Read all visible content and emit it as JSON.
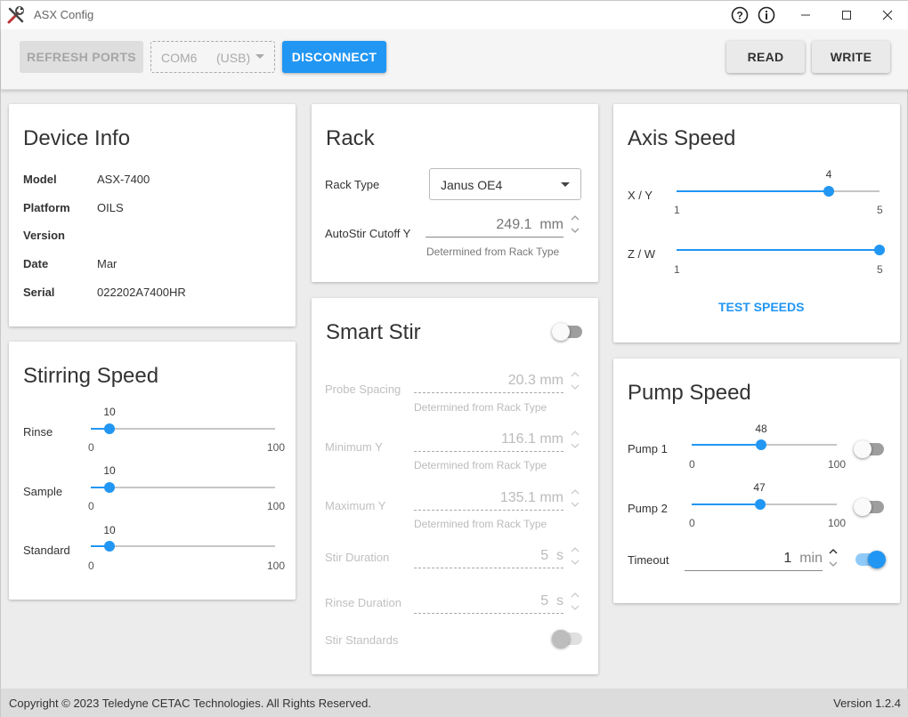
{
  "window": {
    "title": "ASX Config",
    "controls": {
      "help_icon": "help-icon",
      "info_icon": "info-icon"
    }
  },
  "toolbar": {
    "refresh_label": "REFRESH PORTS",
    "port_name": "COM6",
    "port_type": "(USB)",
    "disconnect_label": "DISCONNECT",
    "read_label": "READ",
    "write_label": "WRITE"
  },
  "device_info": {
    "title": "Device Info",
    "rows": [
      {
        "label": "Model",
        "value": "ASX-7400"
      },
      {
        "label": "Platform",
        "value": "OILS"
      },
      {
        "label": "Version",
        "value": ""
      },
      {
        "label": "Date",
        "value": "Mar"
      },
      {
        "label": "Serial",
        "value": "022202A7400HR"
      }
    ]
  },
  "stirring_speed": {
    "title": "Stirring Speed",
    "sliders": [
      {
        "label": "Rinse",
        "value": "10",
        "min": "0",
        "max": "100",
        "fraction": 0.1
      },
      {
        "label": "Sample",
        "value": "10",
        "min": "0",
        "max": "100",
        "fraction": 0.1
      },
      {
        "label": "Standard",
        "value": "10",
        "min": "0",
        "max": "100",
        "fraction": 0.1
      }
    ]
  },
  "rack": {
    "title": "Rack",
    "rack_type_label": "Rack Type",
    "rack_type_value": "Janus OE4",
    "autostir_label": "AutoStir Cutoff Y",
    "autostir_value": "249.1",
    "autostir_unit": "mm",
    "autostir_hint": "Determined from Rack Type"
  },
  "smart_stir": {
    "title": "Smart Stir",
    "enabled": false,
    "fields": [
      {
        "label": "Probe Spacing",
        "value": "20.3",
        "unit": "mm",
        "hint": "Determined from Rack Type"
      },
      {
        "label": "Minimum Y",
        "value": "116.1",
        "unit": "mm",
        "hint": "Determined from Rack Type"
      },
      {
        "label": "Maximum Y",
        "value": "135.1",
        "unit": "mm",
        "hint": "Determined from Rack Type"
      },
      {
        "label": "Stir Duration",
        "value": "5",
        "unit": "s",
        "hint": ""
      },
      {
        "label": "Rinse Duration",
        "value": "5",
        "unit": "s",
        "hint": ""
      }
    ],
    "stir_standards_label": "Stir Standards",
    "stir_standards_on": false
  },
  "axis_speed": {
    "title": "Axis Speed",
    "sliders": [
      {
        "label": "X / Y",
        "value": "4",
        "min": "1",
        "max": "5",
        "fraction": 0.75,
        "show_value": true
      },
      {
        "label": "Z / W",
        "value": "5",
        "min": "1",
        "max": "5",
        "fraction": 1.0,
        "show_value": false
      }
    ],
    "test_label": "TEST SPEEDS"
  },
  "pump_speed": {
    "title": "Pump Speed",
    "pumps": [
      {
        "label": "Pump 1",
        "value": "48",
        "min": "0",
        "max": "100",
        "fraction": 0.48,
        "on": false
      },
      {
        "label": "Pump 2",
        "value": "47",
        "min": "0",
        "max": "100",
        "fraction": 0.47,
        "on": false
      }
    ],
    "timeout_label": "Timeout",
    "timeout_value": "1",
    "timeout_unit": "min",
    "timeout_on": true
  },
  "footer": {
    "copyright": "Copyright © 2023 Teledyne CETAC Technologies. All Rights Reserved.",
    "version": "Version 1.2.4"
  },
  "colors": {
    "accent": "#2196f3",
    "background": "#ececec",
    "card": "#ffffff"
  }
}
